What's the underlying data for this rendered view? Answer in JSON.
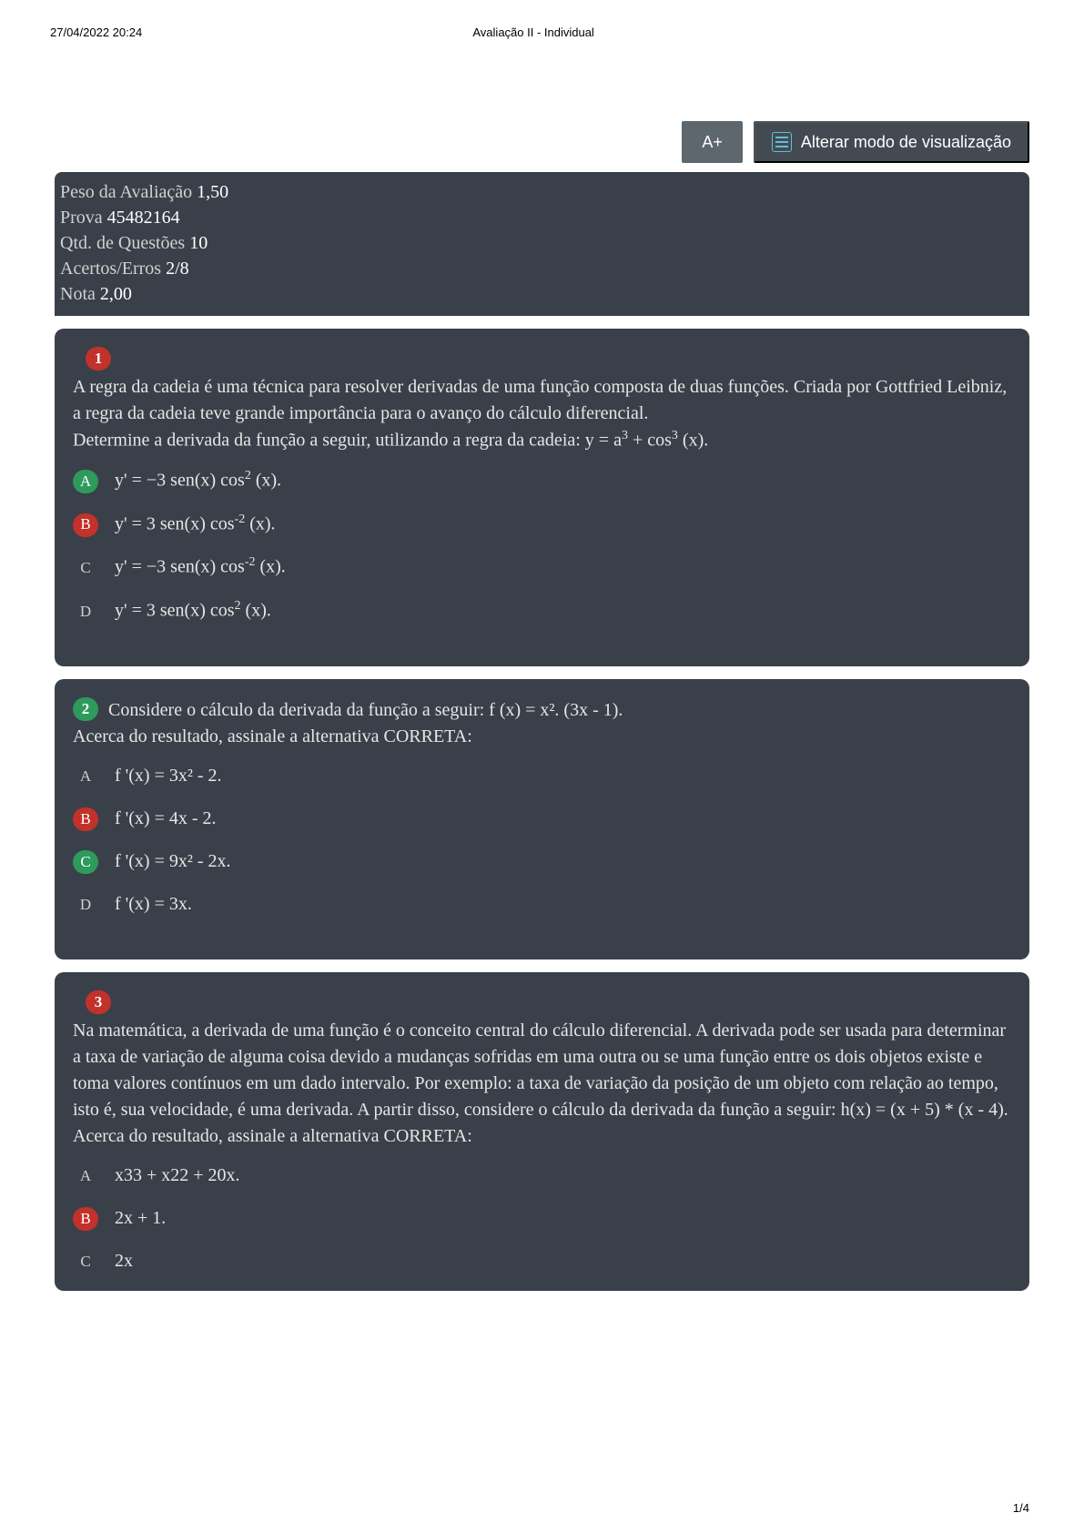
{
  "header": {
    "timestamp": "27/04/2022 20:24",
    "title": "Avaliação II - Individual"
  },
  "footer": {
    "page": "1/4"
  },
  "toolbar": {
    "font_size_label": "A+",
    "view_mode_label": "Alterar modo de visualização"
  },
  "meta": {
    "peso_label": "Peso da Avaliação ",
    "peso_value": "1,50",
    "prova_label": "Prova ",
    "prova_value": "45482164",
    "qtd_label": "Qtd. de Questões ",
    "qtd_value": "10",
    "acertos_label": "Acertos/Erros ",
    "acertos_value": "2/8",
    "nota_label": "Nota ",
    "nota_value": "2,00"
  },
  "q1": {
    "number": "1",
    "text_line1": "A regra da cadeia é uma técnica para resolver derivadas de uma função composta de duas funções. Criada por Gottfried Leibniz, a regra da cadeia teve grande importância para o avanço do cálculo diferencial.",
    "text_line2_prefix": "Determine a derivada da função a seguir, utilizando a regra da cadeia: y = a",
    "text_line2_mid": " + cos",
    "text_line2_suffix": " (x).",
    "sup3a": "3",
    "sup3b": "3",
    "options": {
      "A": {
        "letter": "A",
        "prefix": "y' = −3 sen(x) cos",
        "sup": "2",
        "suffix": " (x)."
      },
      "B": {
        "letter": "B",
        "prefix": "y' = 3 sen(x) cos",
        "sup": "-2",
        "suffix": " (x)."
      },
      "C": {
        "letter": "C",
        "prefix": "y' = −3 sen(x) cos",
        "sup": "-2",
        "suffix": " (x)."
      },
      "D": {
        "letter": "D",
        "prefix": "y' = 3 sen(x) cos",
        "sup": "2",
        "suffix": " (x)."
      }
    }
  },
  "q2": {
    "number": "2",
    "text_line1": "Considere o cálculo da derivada da função a seguir: f (x) = x². (3x - 1).",
    "text_line2": "Acerca do resultado, assinale a alternativa CORRETA:",
    "options": {
      "A": {
        "letter": "A",
        "text": "f '(x) = 3x² - 2."
      },
      "B": {
        "letter": "B",
        "text": "f '(x) = 4x - 2."
      },
      "C": {
        "letter": "C",
        "text": "f '(x) = 9x² - 2x."
      },
      "D": {
        "letter": "D",
        "text": "f '(x) = 3x."
      }
    }
  },
  "q3": {
    "number": "3",
    "text_line1": "Na matemática, a derivada de uma função é o conceito central do cálculo diferencial. A derivada pode ser usada para determinar a taxa de variação de alguma coisa devido a mudanças sofridas em uma outra ou se uma função entre os dois objetos existe e toma valores contínuos em um dado intervalo. Por exemplo: a taxa de variação da posição de um objeto com relação ao tempo, isto é, sua velocidade, é uma derivada. A partir disso, considere o cálculo da derivada da função a seguir: h(x) = (x + 5) * (x - 4).",
    "text_line2": "Acerca do resultado, assinale a alternativa CORRETA:",
    "options": {
      "A": {
        "letter": "A",
        "text": "x33 + x22 + 20x."
      },
      "B": {
        "letter": "B",
        "text": "2x + 1."
      },
      "C": {
        "letter": "C",
        "text": "2x"
      }
    }
  }
}
